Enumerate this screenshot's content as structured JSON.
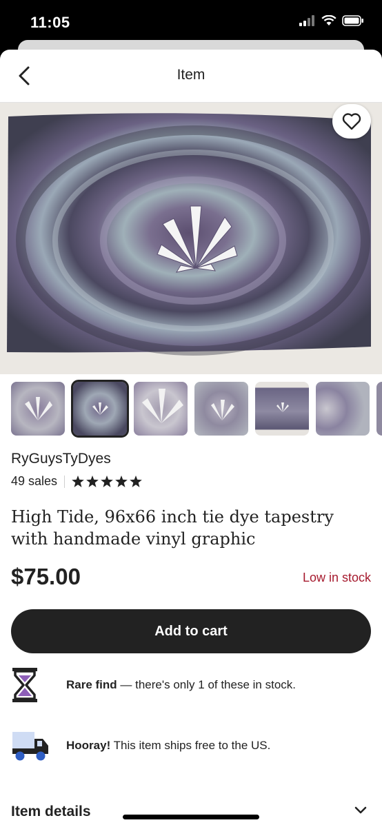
{
  "status": {
    "time": "11:05"
  },
  "nav": {
    "title": "Item"
  },
  "listing": {
    "shop_name": "RyGuysTyDyes",
    "sales": "49 sales",
    "rating": 5,
    "title": "High Tide, 96x66 inch tie dye tapestry with handmade vinyl graphic",
    "price": "$75.00",
    "stock_status": "Low in stock",
    "add_to_cart": "Add to cart",
    "thumbnails_count": 7,
    "selected_thumbnail": 1
  },
  "perks": [
    {
      "icon": "hourglass-icon",
      "bold": "Rare find",
      "text": " — there's only 1 of these in stock."
    },
    {
      "icon": "truck-icon",
      "bold": "Hooray!",
      "text": " This item ships free to the US."
    }
  ],
  "sections": {
    "item_details": "Item details"
  },
  "colors": {
    "price_alert": "#a61a2e",
    "button_bg": "#222222",
    "hourglass_sand": "#8e5fb8",
    "truck_accent": "#2f5ec4"
  }
}
